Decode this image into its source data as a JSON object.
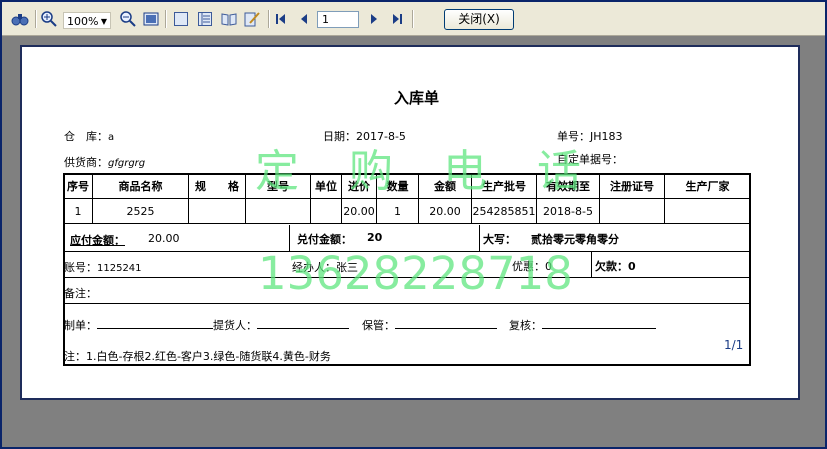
{
  "toolbar": {
    "zoom": "100%",
    "page": "1",
    "close_label": "关闭(X)"
  },
  "report": {
    "title": "入库单",
    "warehouse_label": "仓　库：",
    "warehouse_value": "a",
    "date_label": "日期：",
    "date_value": "2017-8-5",
    "number_label": "单号：",
    "number_value": "JH183",
    "supplier_label": "供货商：",
    "supplier_value": "gfgrgrg",
    "custom_no_label": "自定单据号：",
    "columns": [
      "序号",
      "商品名称",
      "规　　格",
      "型号",
      "单位",
      "进价",
      "数量",
      "金额",
      "生产批号",
      "有效期至",
      "注册证号",
      "生产厂家"
    ],
    "row": [
      "1",
      "2525",
      "",
      "",
      "",
      "20.00",
      "1",
      "20.00",
      "254285851",
      "2018-8-5",
      "",
      ""
    ],
    "payable_label": "应付金额：",
    "payable_value": "20.00",
    "paid_label": "兑付金额：",
    "paid_value": "20",
    "capital_label": "大写：",
    "capital_value": "贰拾零元零角零分",
    "account_label": "账号：",
    "account_value": "1125241",
    "handler_label": "经办人：",
    "handler_value": "张三",
    "discount_label": "优惠：",
    "discount_value": "0",
    "debt_label": "欠款：",
    "debt_value": "0",
    "remark_label": "备注：",
    "maker_label": "制单：",
    "picker_label": "提货人：",
    "keeper_label": "保管：",
    "reviewer_label": "复核：",
    "note": "注：1.白色-存根2.红色-客户3.绿色-随货联4.黄色-财务",
    "page_indicator": "1/1"
  },
  "watermark": {
    "line1": "定 购 电 话",
    "line2": "13628228718",
    "color": "#5fe67f"
  }
}
